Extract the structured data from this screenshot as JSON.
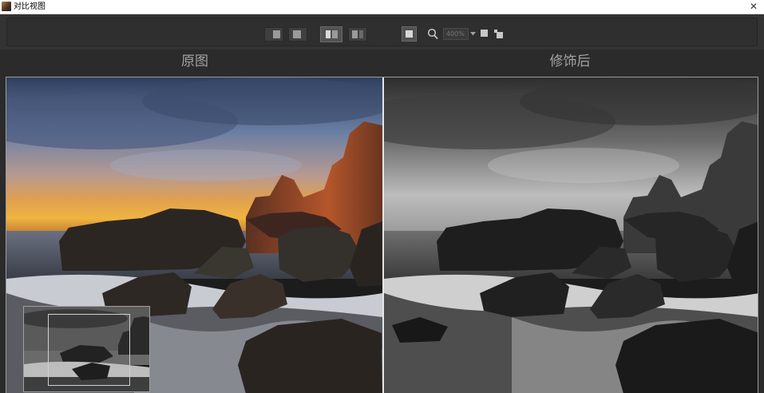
{
  "window": {
    "title": "对比视图",
    "close_glyph": "✕"
  },
  "toolbar": {
    "zoom_value": "400%",
    "buttons": [
      {
        "name": "view-single-button"
      },
      {
        "name": "view-split-button"
      },
      {
        "name": "view-side-by-side-button",
        "active": true
      },
      {
        "name": "view-swap-button"
      },
      {
        "name": "fit-screen-button",
        "active": true
      },
      {
        "name": "zoom-icon"
      },
      {
        "name": "zoom-dropdown-button"
      },
      {
        "name": "fill-screen-button"
      }
    ]
  },
  "panels": {
    "original_label": "原图",
    "retouched_label": "修饰后"
  },
  "colors": {
    "background": "#2b2b2b",
    "toolbar": "#333333",
    "label_text": "#a3a3a3",
    "divider": "#e6e6e6"
  }
}
